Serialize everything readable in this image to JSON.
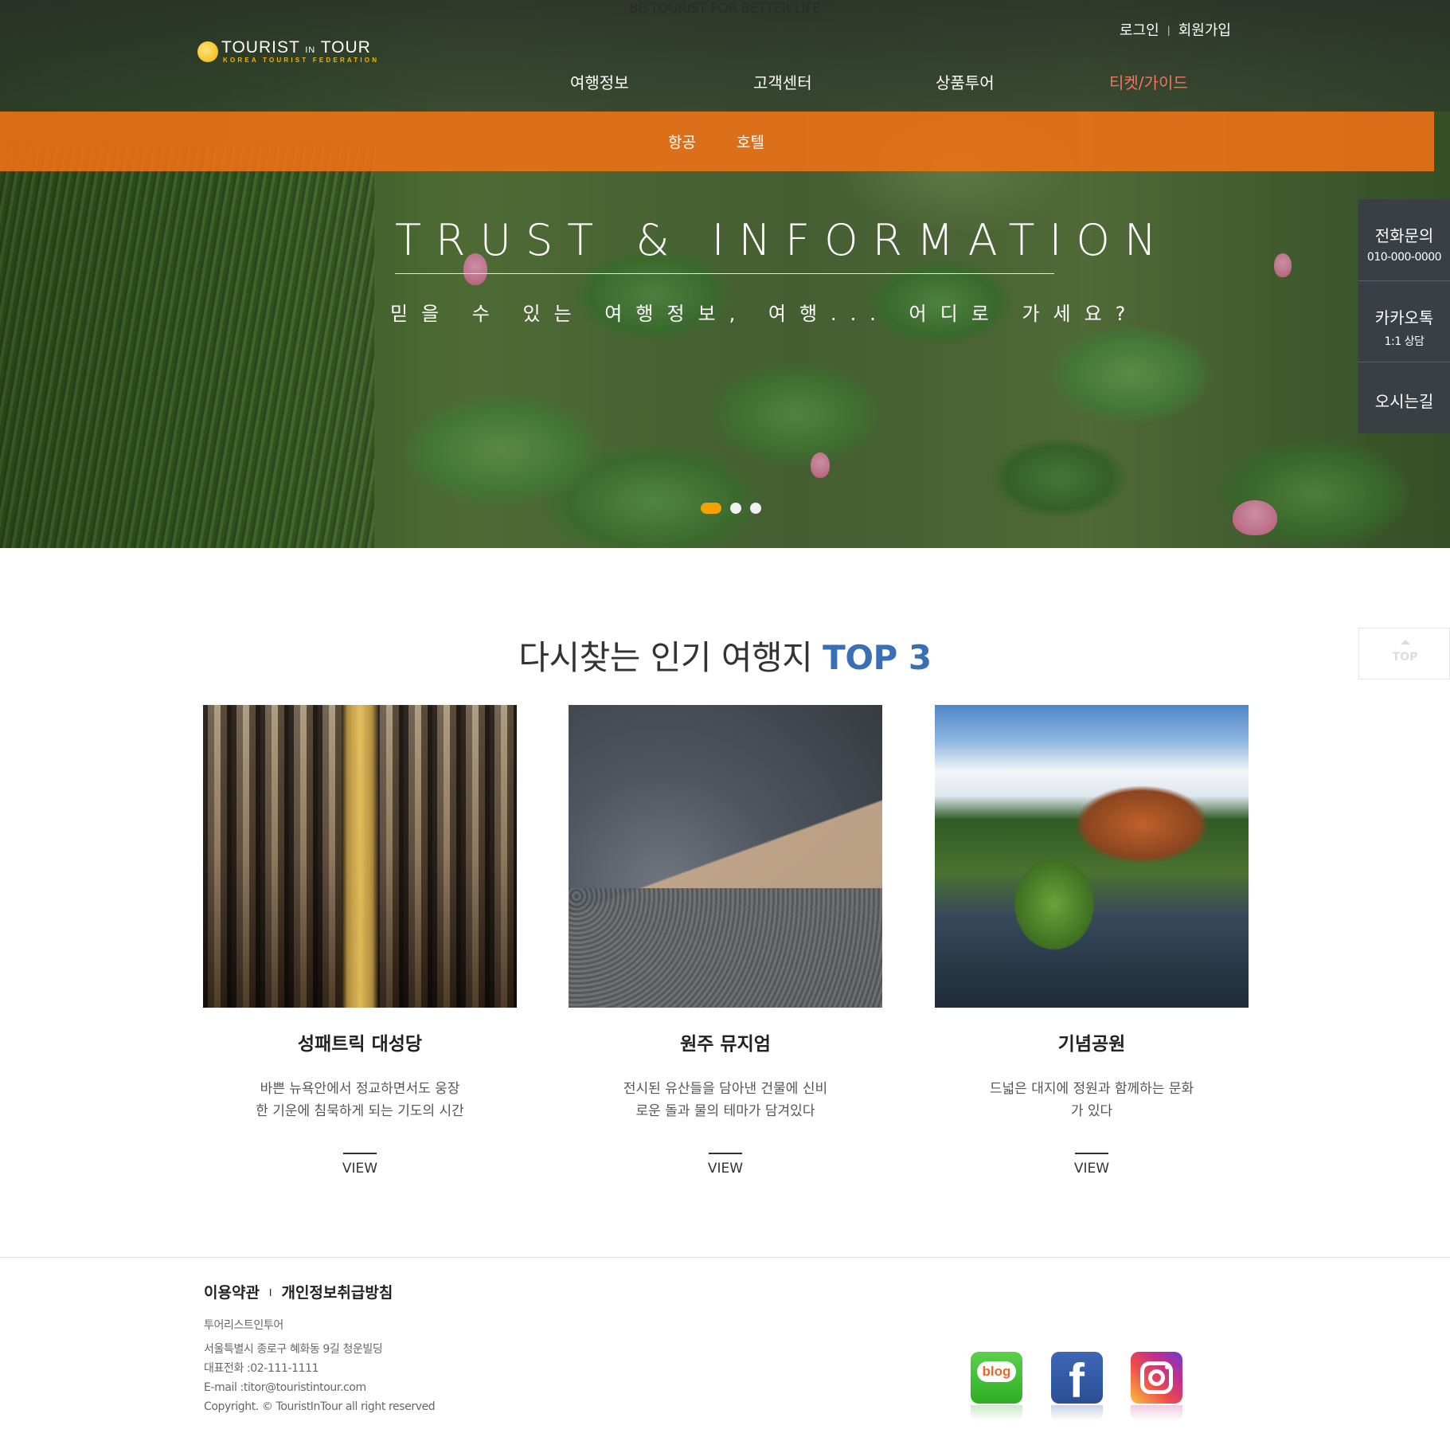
{
  "header": {
    "tagline": "BE TOURIST FOR BETTER LIFE",
    "logo": {
      "title_a": "TOURIST",
      "title_in": "IN",
      "title_b": "TOUR",
      "subtitle": "KOREA TOURIST FEDERATION"
    },
    "auth": {
      "login": "로그인",
      "separator": "|",
      "signup": "회원가입"
    },
    "nav": [
      {
        "label": "여행정보"
      },
      {
        "label": "고객센터"
      },
      {
        "label": "상품투어"
      },
      {
        "label": "티켓/가이드",
        "active": true
      }
    ],
    "subnav": [
      {
        "label": "항공"
      },
      {
        "label": "호텔"
      }
    ]
  },
  "hero": {
    "title": "TRUST & INFORMATION",
    "subtitle": "믿을 수 있는 여행정보, 여행... 어디로 가세요?",
    "slides": {
      "count": 3,
      "active_index": 0
    }
  },
  "quick_panel": {
    "phone": {
      "label": "전화문의",
      "number": "010-000-0000"
    },
    "kakao": {
      "label": "카카오톡",
      "sub": "1:1 상담"
    },
    "directions": {
      "label": "오시는길"
    },
    "top_button": "TOP"
  },
  "top3": {
    "title_main": "다시찾는 인기 여행지",
    "title_accent": "TOP 3",
    "cards": [
      {
        "title": "성패트릭 대성당",
        "desc_line1": "바쁜 뉴욕안에서 정교하면서도 웅장",
        "desc_line2": "한 기운에 침묵하게 되는 기도의 시간",
        "cta": "VIEW"
      },
      {
        "title": "원주 뮤지엄",
        "desc_line1": "전시된 유산들을 담아낸 건물에 신비",
        "desc_line2": "로운 돌과 물의 테마가 담겨있다",
        "cta": "VIEW"
      },
      {
        "title": "기념공원",
        "desc_line1": "드넓은 대지에 정원과 함께하는 문화",
        "desc_line2": "가 있다",
        "cta": "VIEW"
      }
    ]
  },
  "footer": {
    "links": {
      "terms": "이용약관",
      "separator": "I",
      "privacy": "개인정보취급방침"
    },
    "company": "투어리스트인투어",
    "address": "서울특별시 종로구 혜화동 9길 청운빌딩",
    "phone": "대표전화 :02-111-1111",
    "email": "E-mail :titor@touristintour.com",
    "copyright": "Copyright. © TouristInTour all right reserved",
    "social": {
      "blog_label": "blog",
      "facebook_label": "f"
    }
  },
  "colors": {
    "accent_orange": "#ec7116",
    "active_nav": "#f0765e",
    "title_accent": "#3a6fb5",
    "quick_panel_bg": "#3a3e46",
    "slider_active": "#f5a200"
  },
  "icons": [
    "sun-logo-icon",
    "up-arrow-icon",
    "blog-icon",
    "facebook-icon",
    "instagram-icon"
  ]
}
